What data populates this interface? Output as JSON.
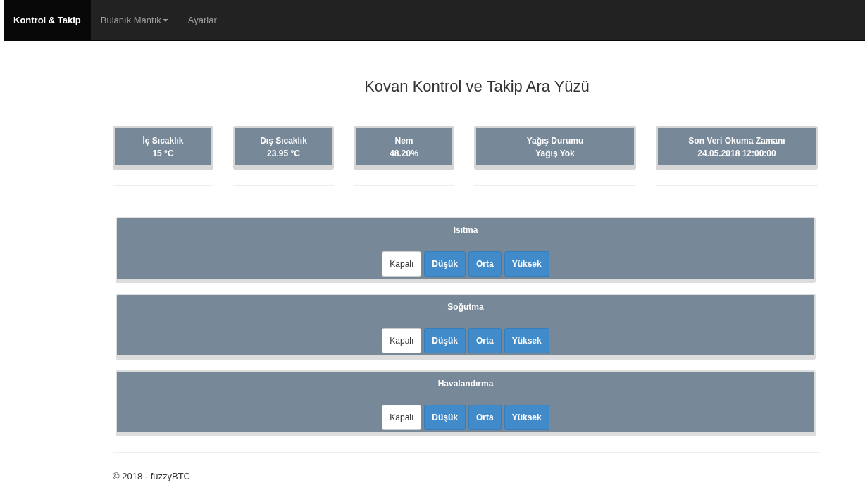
{
  "navbar": {
    "items": [
      {
        "label": "Kontrol & Takip",
        "selected": true,
        "dropdown": false
      },
      {
        "label": "Bulanık Mantık",
        "selected": false,
        "dropdown": true
      },
      {
        "label": "Ayarlar",
        "selected": false,
        "dropdown": false
      }
    ]
  },
  "title": "Kovan Kontrol ve Takip Ara Yüzü",
  "cards": [
    {
      "label": "İç Sıcaklık",
      "value": "15 °C",
      "wide": false
    },
    {
      "label": "Dış Sıcaklık",
      "value": "23.95 °C",
      "wide": false
    },
    {
      "label": "Nem",
      "value": "48.20%",
      "wide": false
    },
    {
      "label": "Yağış Durumu",
      "value": "Yağış Yok",
      "wide": true
    },
    {
      "label": "Son Veri Okuma Zamanı",
      "value": "24.05.2018 12:00:00",
      "wide": true
    }
  ],
  "panels": [
    {
      "title": "Isıtma",
      "options": [
        {
          "label": "Kapalı",
          "selected": true
        },
        {
          "label": "Düşük",
          "selected": false
        },
        {
          "label": "Orta",
          "selected": false
        },
        {
          "label": "Yüksek",
          "selected": false
        }
      ]
    },
    {
      "title": "Soğutma",
      "options": [
        {
          "label": "Kapalı",
          "selected": true
        },
        {
          "label": "Düşük",
          "selected": false
        },
        {
          "label": "Orta",
          "selected": false
        },
        {
          "label": "Yüksek",
          "selected": false
        }
      ]
    },
    {
      "title": "Havalandırma",
      "options": [
        {
          "label": "Kapalı",
          "selected": true
        },
        {
          "label": "Düşük",
          "selected": false
        },
        {
          "label": "Orta",
          "selected": false
        },
        {
          "label": "Yüksek",
          "selected": false
        }
      ]
    }
  ],
  "footer": "© 2018 - fuzzyBTC"
}
